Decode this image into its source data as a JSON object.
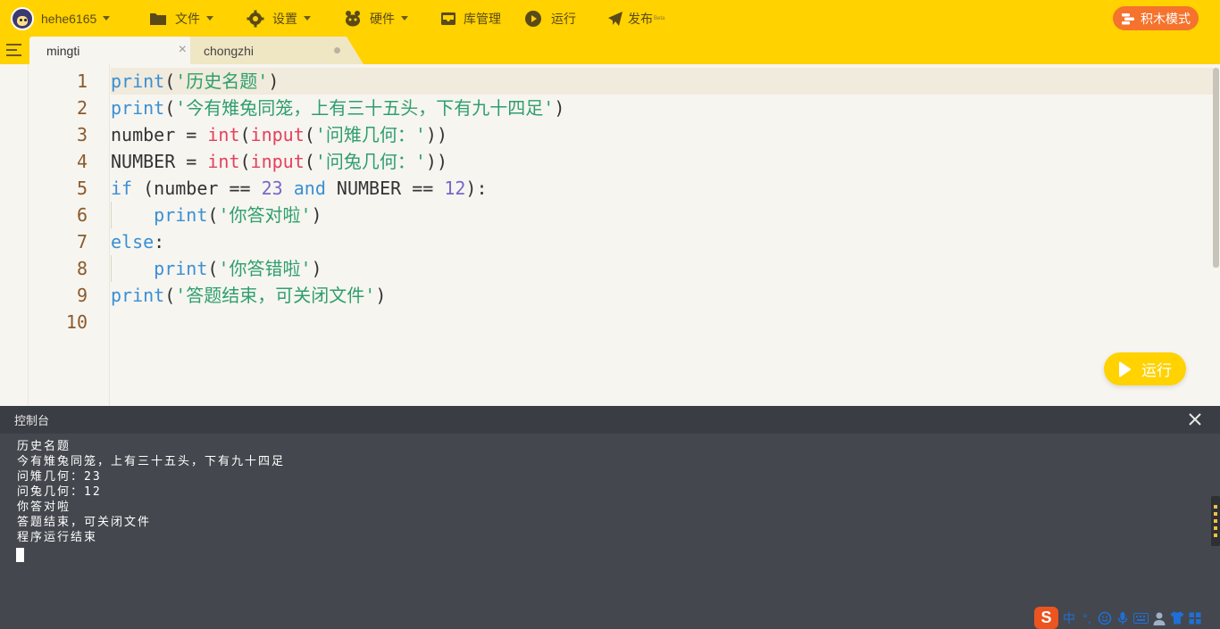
{
  "toolbar": {
    "username": "hehe6165",
    "file_label": "文件",
    "settings_label": "设置",
    "hardware_label": "硬件",
    "library_label": "库管理",
    "run_label": "运行",
    "publish_label": "发布",
    "publish_badge": "Beta",
    "block_mode_label": "积木模式",
    "accent_color": "#ffd200",
    "block_mode_color": "#f5732c"
  },
  "tabs": [
    {
      "name": "mingti",
      "close_icon": "×"
    },
    {
      "name": "chongzhi"
    }
  ],
  "editor": {
    "line_numbers": [
      "1",
      "2",
      "3",
      "4",
      "5",
      "6",
      "7",
      "8",
      "9",
      "10"
    ],
    "run_button_label": "运行"
  },
  "console": {
    "title": "控制台",
    "lines": [
      "历史名题",
      "今有雉兔同笼，上有三十五头，下有九十四足",
      "问雉几何：23",
      "问兔几何：12",
      "你答对啦",
      "答题结束，可关闭文件",
      "程序运行结束"
    ]
  },
  "ime": {
    "logo": "S",
    "mode": "中"
  }
}
